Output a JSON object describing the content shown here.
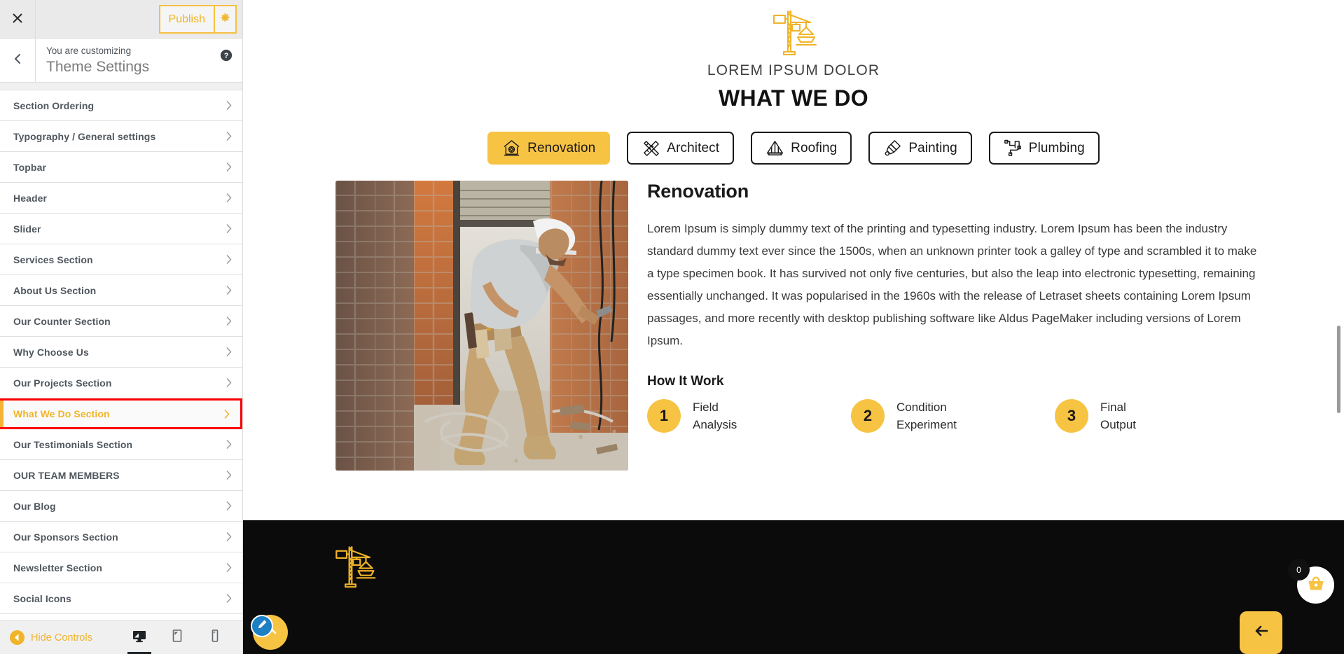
{
  "customizer": {
    "close_icon": "close-icon",
    "publish_label": "Publish",
    "gear_icon": "gear-icon",
    "back_icon": "chevron-left-icon",
    "customizing_label": "You are customizing",
    "theme_title": "Theme Settings",
    "help_icon": "help-icon",
    "sections": [
      {
        "label": "Section Ordering",
        "active": false
      },
      {
        "label": "Typography / General settings",
        "active": false
      },
      {
        "label": "Topbar",
        "active": false
      },
      {
        "label": "Header",
        "active": false
      },
      {
        "label": "Slider",
        "active": false
      },
      {
        "label": "Services Section",
        "active": false
      },
      {
        "label": "About Us Section",
        "active": false
      },
      {
        "label": "Our Counter Section",
        "active": false
      },
      {
        "label": "Why Choose Us",
        "active": false
      },
      {
        "label": "Our Projects Section",
        "active": false
      },
      {
        "label": "What We Do Section",
        "active": true
      },
      {
        "label": "Our Testimonials Section",
        "active": false
      },
      {
        "label": "OUR TEAM MEMBERS",
        "active": false
      },
      {
        "label": "Our Blog",
        "active": false
      },
      {
        "label": "Our Sponsors Section",
        "active": false
      },
      {
        "label": "Newsletter Section",
        "active": false
      },
      {
        "label": "Social Icons",
        "active": false
      }
    ],
    "footer": {
      "hide_controls_label": "Hide Controls",
      "hide_controls_icon": "collapse-left-icon",
      "devices": [
        {
          "name": "desktop",
          "icon": "desktop-icon",
          "active": true
        },
        {
          "name": "tablet",
          "icon": "tablet-icon",
          "active": false
        },
        {
          "name": "mobile",
          "icon": "mobile-icon",
          "active": false
        }
      ]
    },
    "colors": {
      "accent": "#f0b429",
      "active_outline": "#ff0000",
      "active_bar": "#f5b335",
      "topbar_bg": "#eaeaea",
      "label": "#50575e"
    }
  },
  "preview": {
    "brand": {
      "logo_icon": "crane-icon",
      "subtitle": "LOREM IPSUM DOLOR",
      "title": "WHAT WE DO"
    },
    "tabs": [
      {
        "label": "Renovation",
        "icon": "house-renovation-icon",
        "active": true
      },
      {
        "label": "Architect",
        "icon": "ruler-pencil-icon",
        "active": false
      },
      {
        "label": "Roofing",
        "icon": "roof-icon",
        "active": false
      },
      {
        "label": "Painting",
        "icon": "paint-brush-icon",
        "active": false
      },
      {
        "label": "Plumbing",
        "icon": "pipes-icon",
        "active": false
      }
    ],
    "panel": {
      "image_alt": "construction-worker-brick-wall-photo",
      "heading": "Renovation",
      "paragraph": "Lorem Ipsum is simply dummy text of the printing and typesetting industry. Lorem Ipsum has been the industry standard dummy text ever since the 1500s, when an unknown printer took a galley of type and scrambled it to make a type specimen book. It has survived not only five centuries, but also the leap into electronic typesetting, remaining essentially unchanged. It was popularised in the 1960s with the release of Letraset sheets containing Lorem Ipsum passages, and more recently with desktop publishing software like Aldus PageMaker including versions of Lorem Ipsum.",
      "how_it_work_title": "How It Work",
      "steps": [
        {
          "number": "1",
          "line1": "Field",
          "line2": "Analysis"
        },
        {
          "number": "2",
          "line1": "Condition",
          "line2": "Experiment"
        },
        {
          "number": "3",
          "line1": "Final",
          "line2": "Output"
        }
      ]
    },
    "footer": {
      "logo_icon": "crane-icon"
    },
    "widgets": {
      "scroll_top_icon": "chevron-up-icon",
      "edit_icon": "pencil-icon",
      "back_icon": "arrow-left-icon",
      "cart_icon": "basket-icon",
      "cart_count": "0"
    },
    "colors": {
      "accent": "#f7c343",
      "footer_bg": "#0b0b0b",
      "text": "#3a3a3a"
    }
  }
}
